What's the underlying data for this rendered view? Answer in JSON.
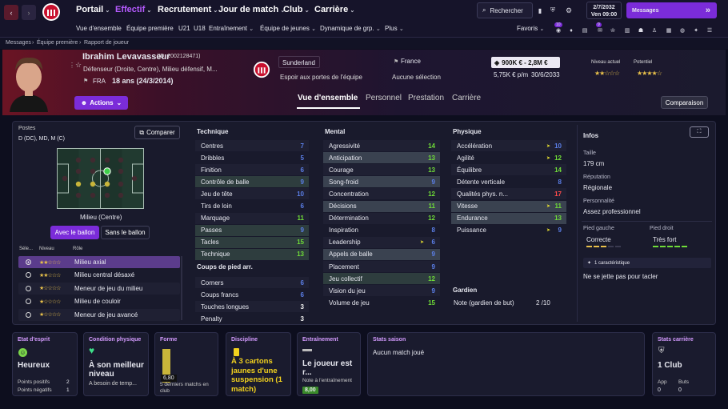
{
  "nav": {
    "main": [
      "Portail",
      "Effectif",
      "Recrutement",
      "Jour de match",
      "Club",
      "Carrière"
    ],
    "search_label": "Rechercher",
    "date": "2/7/2032",
    "day_time": "Ven  09:00",
    "messages_label": "Messages",
    "sub": [
      "Vue d'ensemble",
      "Équipe première",
      "U21",
      "U18",
      "Entraînement",
      "Équipe de jeunes",
      "Dynamique de grp.",
      "Plus"
    ],
    "favoris": "Favoris",
    "fav_badge1": "10",
    "fav_badge2": "9"
  },
  "breadcrumb": [
    "Messages",
    "Équipe première",
    "Rapport de joueur"
  ],
  "player": {
    "name": "Ibrahim Levavasseur",
    "id": "(ID: 2002128471)",
    "positions": "Défenseur (Droite, Centre), Milieu défensif, M...",
    "nation_code": "FRA",
    "age": "18 ans (24/3/2014)",
    "club": "Sunderland",
    "club_role": "Espoir aux portes de l'équipe",
    "nation": "France",
    "selection": "Aucune sélection",
    "value": "900K € - 2,8M €",
    "wage": "5,75K € p/m",
    "contract": "30/6/2033",
    "level_label": "Niveau actuel",
    "potential_label": "Potentiel",
    "level_stars": "★★☆☆☆",
    "potential_stars": "★★★★☆"
  },
  "actions_label": "Actions",
  "comparison_label": "Comparaison",
  "tabs": [
    "Vue d'ensemble",
    "Personnel",
    "Prestation",
    "Carrière"
  ],
  "left": {
    "postes_label": "Postes",
    "postes": "D (DC), MD, M (C)",
    "compare": "Comparer",
    "pitch_caption": "Milieu (Centre)",
    "with_ball": "Avec le ballon",
    "without_ball": "Sans le ballon",
    "cols": [
      "Séle...",
      "Niveau",
      "Rôle"
    ],
    "roles": [
      {
        "stars": "★★☆☆☆",
        "name": "Milieu axial"
      },
      {
        "stars": "★★☆☆☆",
        "name": "Milieu central désaxé"
      },
      {
        "stars": "★☆☆☆☆",
        "name": "Meneur de jeu du milieu"
      },
      {
        "stars": "★☆☆☆☆",
        "name": "Milieu de couloir"
      },
      {
        "stars": "★☆☆☆☆",
        "name": "Meneur de jeu avancé"
      }
    ]
  },
  "attributes": {
    "technique_title": "Technique",
    "technique": [
      {
        "n": "Centres",
        "v": "7"
      },
      {
        "n": "Dribbles",
        "v": "5"
      },
      {
        "n": "Finition",
        "v": "6"
      },
      {
        "n": "Contrôle de balle",
        "v": "9"
      },
      {
        "n": "Jeu de tête",
        "v": "10"
      },
      {
        "n": "Tirs de loin",
        "v": "6"
      },
      {
        "n": "Marquage",
        "v": "11"
      },
      {
        "n": "Passes",
        "v": "9"
      },
      {
        "n": "Tacles",
        "v": "15"
      },
      {
        "n": "Technique",
        "v": "13"
      }
    ],
    "setpieces_title": "Coups de pied arr.",
    "setpieces": [
      {
        "n": "Corners",
        "v": "6"
      },
      {
        "n": "Coups francs",
        "v": "6"
      },
      {
        "n": "Touches longues",
        "v": "3"
      },
      {
        "n": "Penalty",
        "v": "3"
      }
    ],
    "mental_title": "Mental",
    "mental": [
      {
        "n": "Agressivité",
        "v": "14"
      },
      {
        "n": "Anticipation",
        "v": "13"
      },
      {
        "n": "Courage",
        "v": "13"
      },
      {
        "n": "Song-froid",
        "v": "9"
      },
      {
        "n": "Concentration",
        "v": "12"
      },
      {
        "n": "Décisions",
        "v": "11"
      },
      {
        "n": "Détermination",
        "v": "12"
      },
      {
        "n": "Inspiration",
        "v": "8"
      },
      {
        "n": "Leadership",
        "v": "6"
      },
      {
        "n": "Appels de balle",
        "v": "9"
      },
      {
        "n": "Placement",
        "v": "9"
      },
      {
        "n": "Jeu collectif",
        "v": "12"
      },
      {
        "n": "Vision du jeu",
        "v": "9"
      },
      {
        "n": "Volume de jeu",
        "v": "15"
      }
    ],
    "physique_title": "Physique",
    "physique": [
      {
        "n": "Accélération",
        "v": "10"
      },
      {
        "n": "Agilité",
        "v": "12"
      },
      {
        "n": "Équilibre",
        "v": "14"
      },
      {
        "n": "Détente verticale",
        "v": "8"
      },
      {
        "n": "Qualités phys. n...",
        "v": "17"
      },
      {
        "n": "Vitesse",
        "v": "11"
      },
      {
        "n": "Endurance",
        "v": "13"
      },
      {
        "n": "Puissance",
        "v": "9"
      }
    ],
    "gk_title": "Gardien",
    "gk_label": "Note (gardien de but)",
    "gk_value": "2 /10"
  },
  "info": {
    "title": "Infos",
    "height_label": "Taille",
    "height": "179 cm",
    "rep_label": "Réputation",
    "rep": "Régionale",
    "pers_label": "Personnalité",
    "pers": "Assez professionnel",
    "left_foot_label": "Pied gauche",
    "left_foot": "Correcte",
    "right_foot_label": "Pied droit",
    "right_foot": "Très fort",
    "traits_count": "1 caractéristique",
    "trait": "Ne se jette pas pour tacler"
  },
  "cards": {
    "mind_title": "Etat d'esprit",
    "mind": "Heureux",
    "pos_label": "Points positifs",
    "pos_val": "2",
    "neg_label": "Points négatifs",
    "neg_val": "1",
    "cond_title": "Condition physique",
    "cond": "À son meilleur niveau",
    "cond_sub": "A besoin de temp...",
    "form_title": "Forme",
    "form_val": "6,80",
    "form_sub": "5 derniers matchs en club",
    "disc_title": "Discipline",
    "disc": "À 3 cartons jaunes d'une suspension (1 match)",
    "train_title": "Entraînement",
    "train": "Le joueur est r...",
    "train_sub": "Note à l'entraînement",
    "train_val": "8,00",
    "season_title": "Stats saison",
    "season": "Aucun match joué",
    "career_title": "Stats carrière",
    "career": "1 Club",
    "apps_label": "App",
    "apps": "0",
    "goals_label": "Buts",
    "goals": "0"
  },
  "colors": {
    "accent": "#8a3ee8",
    "green": "#6fdc38",
    "blue": "#5b7fe8",
    "red": "#ff4b4b"
  }
}
